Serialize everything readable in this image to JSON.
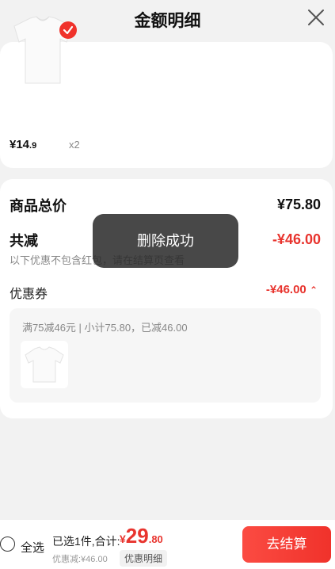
{
  "header": {
    "title": "金额明细"
  },
  "items": [
    {
      "price_int": "¥14",
      "price_dec": ".9",
      "qty": "x2"
    }
  ],
  "summary": {
    "total_label": "商品总价",
    "total_value": "¥75.80",
    "reduce_label": "共减",
    "reduce_value": "-¥46.00",
    "note": "以下优惠不包含红包，请在结算页查看",
    "coupon_label": "优惠券",
    "coupon_value": "-¥46.00",
    "coupon_rule": "满75减46元 | 小计75.80，已减46.00"
  },
  "toast": {
    "text": "删除成功"
  },
  "bottom": {
    "select_all": "全选",
    "selected_info": "已选1件,合计:",
    "total_cur": "¥",
    "total_int": "29",
    "total_dec": ".80",
    "discount": "优惠减:¥46.00",
    "detail_btn": "优惠明细",
    "checkout": "去结算"
  },
  "colors": {
    "accent": "#e8342e",
    "checkout_start": "#fb4b42",
    "checkout_end": "#f0322b"
  }
}
